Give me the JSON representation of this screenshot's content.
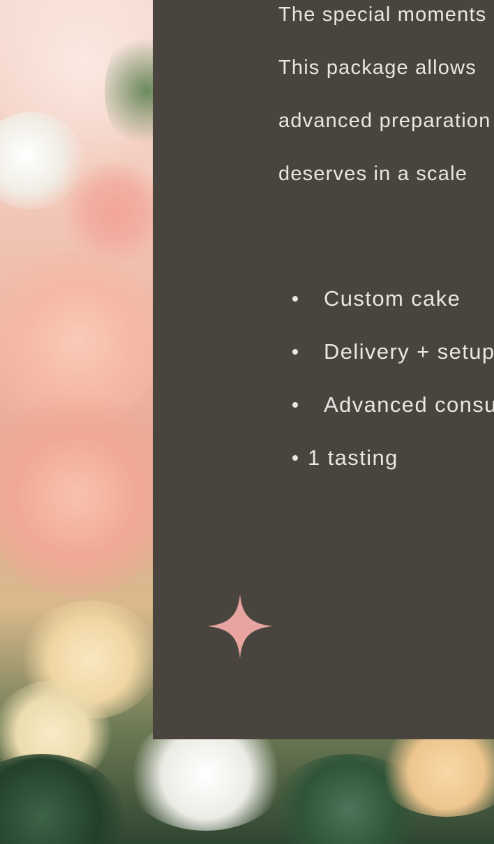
{
  "intro": {
    "lines": [
      "The special moments",
      "This package allows",
      "advanced preparation",
      "deserves in a scale"
    ]
  },
  "features": [
    {
      "label": "Custom cake"
    },
    {
      "label": "Delivery + setup"
    },
    {
      "label": "Advanced consultation"
    },
    {
      "label": "1 tasting"
    }
  ],
  "colors": {
    "panel": "#4a443f",
    "text": "#eae7e3",
    "sparkle": "#e8a4a0"
  },
  "icons": {
    "sparkle": "four-point-star-icon",
    "bullet": "bullet-dot-icon"
  }
}
